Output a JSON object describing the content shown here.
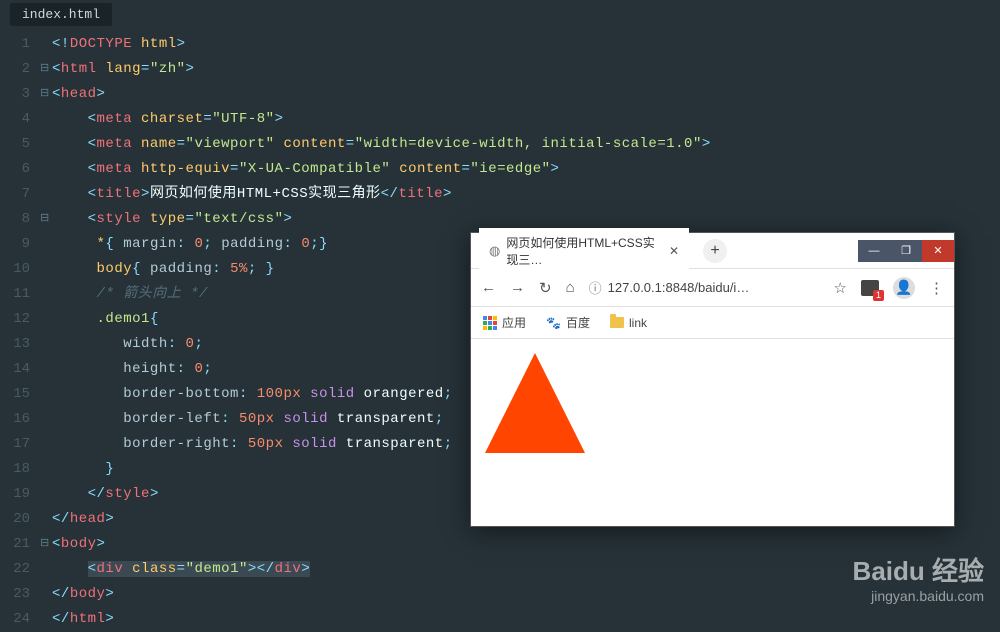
{
  "tab": {
    "filename": "index.html"
  },
  "code": {
    "lines": [
      {
        "n": "1",
        "f": "",
        "html": "<span class='bracket'>&lt;!</span><span class='tag'>DOCTYPE</span> <span class='attr'>html</span><span class='bracket'>&gt;</span>"
      },
      {
        "n": "2",
        "f": "⊟",
        "html": "<span class='bracket'>&lt;</span><span class='tag'>html</span> <span class='attr'>lang</span><span class='op'>=</span><span class='string'>\"zh\"</span><span class='bracket'>&gt;</span>"
      },
      {
        "n": "3",
        "f": "⊟",
        "html": "<span class='bracket'>&lt;</span><span class='tag'>head</span><span class='bracket'>&gt;</span>"
      },
      {
        "n": "4",
        "f": "",
        "html": "    <span class='bracket'>&lt;</span><span class='tag'>meta</span> <span class='attr'>charset</span><span class='op'>=</span><span class='string'>\"UTF-8\"</span><span class='bracket'>&gt;</span>"
      },
      {
        "n": "5",
        "f": "",
        "html": "    <span class='bracket'>&lt;</span><span class='tag'>meta</span> <span class='attr'>name</span><span class='op'>=</span><span class='string'>\"viewport\"</span> <span class='attr'>content</span><span class='op'>=</span><span class='string'>\"width=device-width, initial-scale=1.0\"</span><span class='bracket'>&gt;</span>"
      },
      {
        "n": "6",
        "f": "",
        "html": "    <span class='bracket'>&lt;</span><span class='tag'>meta</span> <span class='attr'>http-equiv</span><span class='op'>=</span><span class='string'>\"X-UA-Compatible\"</span> <span class='attr'>content</span><span class='op'>=</span><span class='string'>\"ie=edge\"</span><span class='bracket'>&gt;</span>"
      },
      {
        "n": "7",
        "f": "",
        "html": "    <span class='bracket'>&lt;</span><span class='tag'>title</span><span class='bracket'>&gt;</span><span class='text'>网页如何使用HTML+CSS实现三角形</span><span class='bracket'>&lt;/</span><span class='tag'>title</span><span class='bracket'>&gt;</span>"
      },
      {
        "n": "8",
        "f": "⊟",
        "html": "    <span class='bracket'>&lt;</span><span class='tag'>style</span> <span class='attr'>type</span><span class='op'>=</span><span class='string'>\"text/css\"</span><span class='bracket'>&gt;</span>"
      },
      {
        "n": "9",
        "f": "",
        "html": "     <span class='sel'>*</span><span class='punct'>{</span> <span class='prop'>margin</span><span class='punct'>:</span> <span class='val'>0</span><span class='punct'>;</span> <span class='prop'>padding</span><span class='punct'>:</span> <span class='val'>0</span><span class='punct'>;}</span>"
      },
      {
        "n": "10",
        "f": "",
        "html": "     <span class='sel'>body</span><span class='punct'>{</span> <span class='prop'>padding</span><span class='punct'>:</span> <span class='val'>5%</span><span class='punct'>; }</span>"
      },
      {
        "n": "11",
        "f": "",
        "html": "     <span class='comment'>/* 箭头向上 */</span>"
      },
      {
        "n": "12",
        "f": "",
        "html": "     <span class='sel2'>.demo1</span><span class='punct'>{</span>"
      },
      {
        "n": "13",
        "f": "",
        "html": "        <span class='prop'>width</span><span class='punct'>:</span> <span class='val'>0</span><span class='punct'>;</span>"
      },
      {
        "n": "14",
        "f": "",
        "html": "        <span class='prop'>height</span><span class='punct'>:</span> <span class='val'>0</span><span class='punct'>;</span>"
      },
      {
        "n": "15",
        "f": "",
        "html": "        <span class='prop'>border-bottom</span><span class='punct'>:</span> <span class='val'>100px</span> <span class='kw'>solid</span> <span class='text'>orangered</span><span class='punct'>;</span>"
      },
      {
        "n": "16",
        "f": "",
        "html": "        <span class='prop'>border-left</span><span class='punct'>:</span> <span class='val'>50px</span> <span class='kw'>solid</span> <span class='text'>transparent</span><span class='punct'>;</span>"
      },
      {
        "n": "17",
        "f": "",
        "html": "        <span class='prop'>border-right</span><span class='punct'>:</span> <span class='val'>50px</span> <span class='kw'>solid</span> <span class='text'>transparent</span><span class='punct'>;</span>"
      },
      {
        "n": "18",
        "f": "",
        "html": "      <span class='punct'>}</span>"
      },
      {
        "n": "19",
        "f": "",
        "html": "    <span class='bracket'>&lt;/</span><span class='tag'>style</span><span class='bracket'>&gt;</span>"
      },
      {
        "n": "20",
        "f": "",
        "html": "<span class='bracket'>&lt;/</span><span class='tag'>head</span><span class='bracket'>&gt;</span>"
      },
      {
        "n": "21",
        "f": "⊟",
        "html": "<span class='bracket'>&lt;</span><span class='tag'>body</span><span class='bracket'>&gt;</span>"
      },
      {
        "n": "22",
        "f": "",
        "html": "    <span class='highlight'><span class='bracket'>&lt;</span><span class='tag'>div</span> <span class='attr'>class</span><span class='op'>=</span><span class='string'>\"demo1\"</span><span class='bracket'>&gt;</span><span class='bracket'>&lt;/</span><span class='tag'>div</span><span class='bracket'>&gt;</span></span>"
      },
      {
        "n": "23",
        "f": "",
        "html": "<span class='bracket'>&lt;/</span><span class='tag'>body</span><span class='bracket'>&gt;</span>"
      },
      {
        "n": "24",
        "f": "",
        "html": "<span class='bracket'>&lt;/</span><span class='tag'>html</span><span class='bracket'>&gt;</span>"
      }
    ]
  },
  "browser": {
    "tab_title": "网页如何使用HTML+CSS实现三…",
    "address": "127.0.0.1:8848/baidu/i…",
    "bookmarks": {
      "apps": "应用",
      "baidu": "百度",
      "link": "link"
    }
  },
  "watermark": {
    "brand": "Baidu 经验",
    "url": "jingyan.baidu.com"
  }
}
